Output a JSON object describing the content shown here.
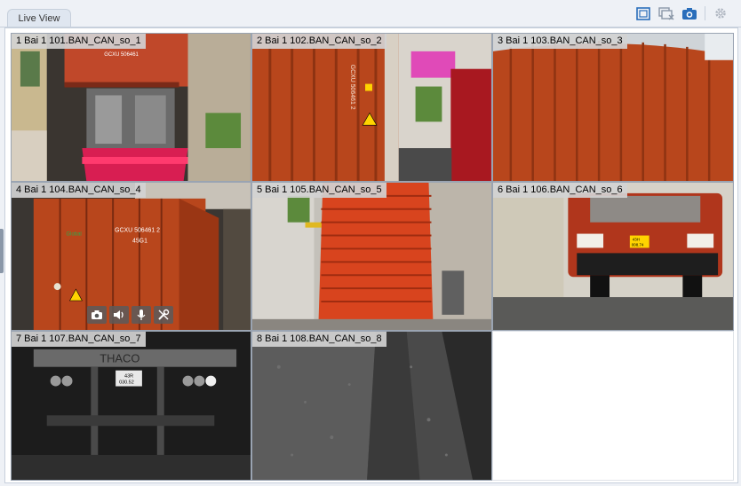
{
  "tab": {
    "label": "Live View"
  },
  "toolbar": {
    "icons": [
      "layout-icon",
      "close-all-windows-icon",
      "capture-icon",
      "settings-icon"
    ]
  },
  "cameras": [
    {
      "label": "1 Bai 1 101.BAN_CAN_so_1"
    },
    {
      "label": "2 Bai 1 102.BAN_CAN_so_2"
    },
    {
      "label": "3 Bai 1 103.BAN_CAN_so_3"
    },
    {
      "label": "4 Bai 1 104.BAN_CAN_so_4"
    },
    {
      "label": "5 Bai 1 105.BAN_CAN_so_5"
    },
    {
      "label": "6 Bai 1 106.BAN_CAN_so_6"
    },
    {
      "label": "7 Bai 1 107.BAN_CAN_so_7"
    },
    {
      "label": "8 Bai 1 108.BAN_CAN_so_8"
    }
  ],
  "overlay_controls": [
    "snapshot-icon",
    "audio-icon",
    "microphone-icon",
    "tools-icon"
  ],
  "feed_text": {
    "cam2_container": "GCXU 506461 2",
    "cam4_container": "GCXU 506461 2 45G1",
    "cam4_brand": "Global",
    "cam6_plate": "43H 008.74",
    "cam7_brand": "THACO",
    "cam7_plate": "43R 030.52"
  },
  "colors": {
    "accent": "#2a6ebb",
    "container": "#b8461c",
    "frame_border": "#c7d0dc"
  }
}
